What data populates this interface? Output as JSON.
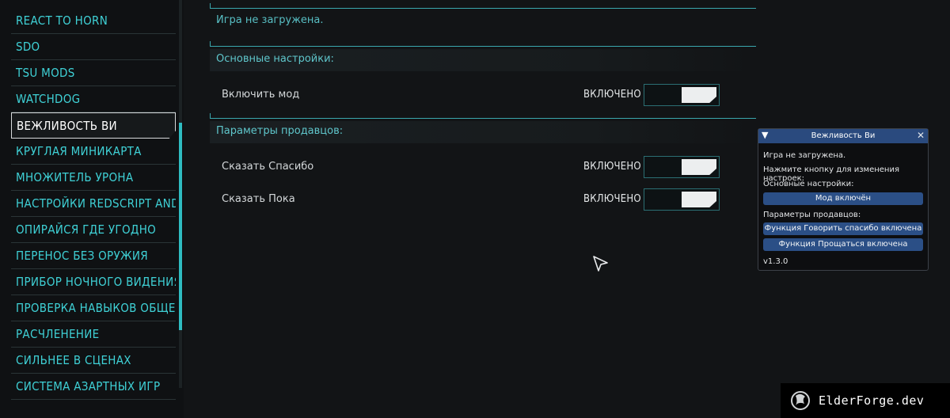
{
  "sidebar": {
    "items": [
      {
        "label": "REACT TO HORN"
      },
      {
        "label": "SDO"
      },
      {
        "label": "TSU MODS"
      },
      {
        "label": "WATCHDOG"
      },
      {
        "label": "ВЕЖЛИВОСТЬ ВИ"
      },
      {
        "label": "КРУГЛАЯ МИНИКАРТА"
      },
      {
        "label": "МНОЖИТЕЛЬ УРОНА"
      },
      {
        "label": "НАСТРОЙКИ REDSCRIPT AND"
      },
      {
        "label": "ОПИРАЙСЯ ГДЕ УГОДНО"
      },
      {
        "label": "ПЕРЕНОС БЕЗ ОРУЖИЯ"
      },
      {
        "label": "ПРИБОР НОЧНОГО ВИДЕНИЯ"
      },
      {
        "label": "ПРОВЕРКА НАВЫКОВ ОБЩЕНИ"
      },
      {
        "label": "РАСЧЛЕНЕНИЕ"
      },
      {
        "label": "СИЛЬНЕЕ В СЦЕНАХ"
      },
      {
        "label": "СИСТЕМА АЗАРТНЫХ ИГР"
      }
    ],
    "selected_index": 4
  },
  "main": {
    "status_text": "Игра не загружена.",
    "sections": [
      {
        "title": "Основные настройки:",
        "settings": [
          {
            "label": "Включить мод",
            "state": "ВКЛЮЧЕНО",
            "enabled": true
          }
        ]
      },
      {
        "title": "Параметры продавцов:",
        "settings": [
          {
            "label": "Сказать Спасибо",
            "state": "ВКЛЮЧЕНО",
            "enabled": true
          },
          {
            "label": "Сказать Пока",
            "state": "ВКЛЮЧЕНО",
            "enabled": true
          }
        ]
      }
    ]
  },
  "imgui_window": {
    "title": "Вежливость Ви",
    "collapse_icon": "triangle-down-icon",
    "close_icon": "close-icon",
    "lines": {
      "status": "Игра не загружена.",
      "hint": "Нажмите кнопку для изменения настроек:",
      "basic_header": "Основные настройки:",
      "mod_button": "Мод включён",
      "vendors_header": "Параметры продавцов:",
      "thanks_button": "Функция Говорить спасибо включена",
      "bye_button": "Функция Прощаться включена",
      "version": "v1.3.0"
    },
    "colors": {
      "titlebar": "#2a4a7e",
      "button": "#2b4f86"
    }
  },
  "watermark": {
    "text": "ElderForge.dev"
  },
  "colors": {
    "accent": "#3fd1d6",
    "background": "#121416",
    "toggle_knob": "#eceeef"
  }
}
